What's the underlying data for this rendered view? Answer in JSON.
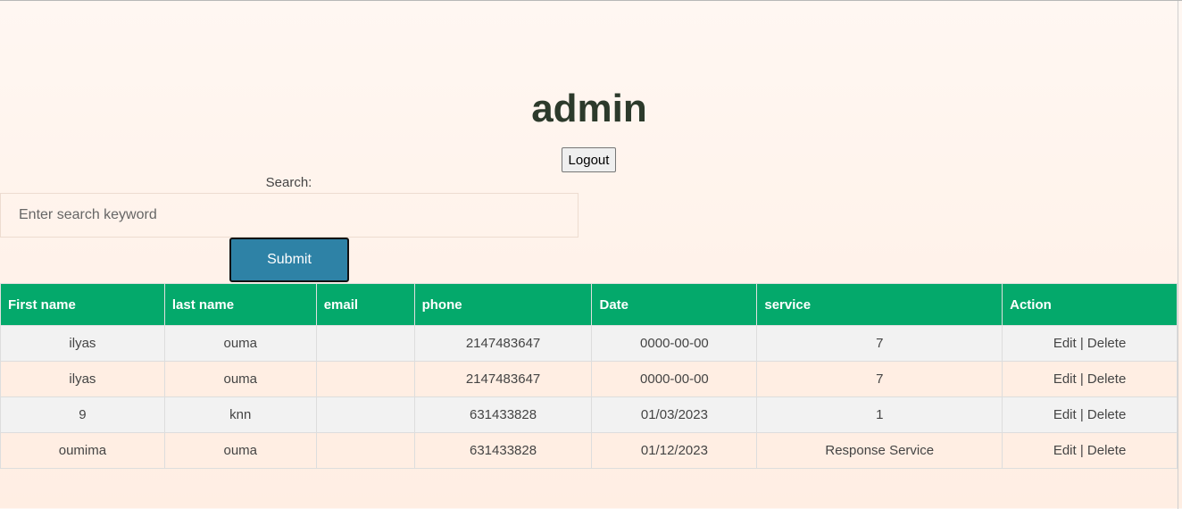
{
  "header": {
    "title": "admin",
    "logout_label": "Logout"
  },
  "search": {
    "label": "Search:",
    "placeholder": "Enter search keyword",
    "value": "",
    "submit_label": "Submit"
  },
  "table": {
    "columns": [
      "First name",
      "last name",
      "email",
      "phone",
      "Date",
      "service",
      "Action"
    ],
    "rows": [
      {
        "first_name": "ilyas",
        "last_name": "ouma",
        "email": "",
        "phone": "2147483647",
        "date": "0000-00-00",
        "service": "7"
      },
      {
        "first_name": "ilyas",
        "last_name": "ouma",
        "email": "",
        "phone": "2147483647",
        "date": "0000-00-00",
        "service": "7"
      },
      {
        "first_name": "9",
        "last_name": "knn",
        "email": "",
        "phone": "631433828",
        "date": "01/03/2023",
        "service": "1"
      },
      {
        "first_name": "oumima",
        "last_name": "ouma",
        "email": "",
        "phone": "631433828",
        "date": "01/12/2023",
        "service": "Response Service"
      }
    ],
    "actions": {
      "edit_label": "Edit",
      "separator": "|",
      "delete_label": "Delete"
    }
  }
}
